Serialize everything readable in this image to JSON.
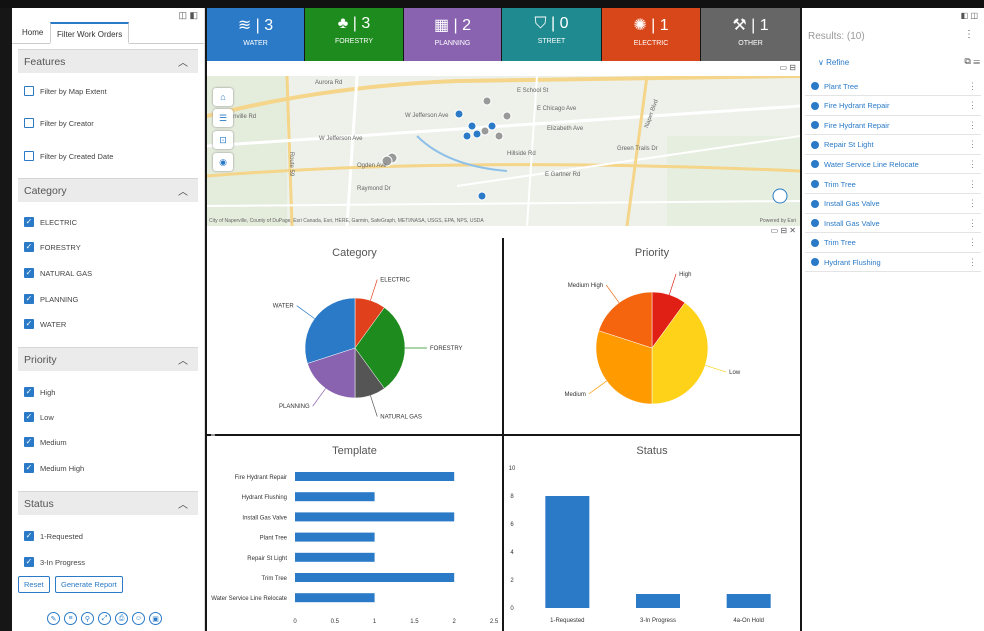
{
  "left_panel": {
    "tabs": [
      "Home",
      "Filter Work Orders"
    ],
    "features": {
      "title": "Features",
      "items": [
        "Filter by Map Extent",
        "Filter by Creator",
        "Filter by Created Date"
      ]
    },
    "category": {
      "title": "Category",
      "items": [
        "ELECTRIC",
        "FORESTRY",
        "NATURAL GAS",
        "PLANNING",
        "WATER"
      ]
    },
    "priority": {
      "title": "Priority",
      "items": [
        "High",
        "Low",
        "Medium",
        "Medium High"
      ]
    },
    "status": {
      "title": "Status",
      "items": [
        "1-Requested",
        "3-In Progress"
      ]
    },
    "reset_label": "Reset",
    "report_label": "Generate Report"
  },
  "tiles": [
    {
      "count": "3",
      "label": "WATER",
      "color": "#2a7ac7"
    },
    {
      "count": "3",
      "label": "FORESTRY",
      "color": "#1e8b1e"
    },
    {
      "count": "2",
      "label": "PLANNING",
      "color": "#8a63b0"
    },
    {
      "count": "0",
      "label": "STREET",
      "color": "#1f8a8f"
    },
    {
      "count": "1",
      "label": "ELECTRIC",
      "color": "#d8471a"
    },
    {
      "count": "1",
      "label": "OTHER",
      "color": "#666666"
    }
  ],
  "map": {
    "attribution": "City of Naperville, County of DuPage, Esri Canada, Esri, HERE, Garmin, SafeGraph, METI/NASA, USGS, EPA, NPS, USDA",
    "powered": "Powered by Esri",
    "roads": [
      "Aurora Rd",
      "W Jefferson Ave",
      "W Jefferson Ave",
      "E Chicago Ave",
      "Ogden Ave",
      "Hillside Rd",
      "E Gartner Rd",
      "Route 59",
      "E School St",
      "Elizabeth Ave",
      "Naper Blvd",
      "Green Trails Dr",
      "Raymond Dr",
      "Warrenville Rd"
    ]
  },
  "results": {
    "title": "Results: (10)",
    "refine": "Refine",
    "items": [
      "Plant Tree",
      "Fire Hydrant Repair",
      "Fire Hydrant Repair",
      "Repair St Light",
      "Water Service Line Relocate",
      "Trim Tree",
      "Install Gas Valve",
      "Install Gas Valve",
      "Trim Tree",
      "Hydrant Flushing"
    ]
  },
  "chart_data": [
    {
      "type": "pie",
      "title": "Category",
      "categories": [
        "ELECTRIC",
        "FORESTRY",
        "NATURAL GAS",
        "PLANNING",
        "WATER"
      ],
      "values": [
        1,
        3,
        1,
        2,
        3
      ],
      "colors": [
        "#e0401c",
        "#1e8b1e",
        "#555555",
        "#8a63b0",
        "#2a7ac7"
      ]
    },
    {
      "type": "pie",
      "title": "Priority",
      "categories": [
        "High",
        "Low",
        "Medium",
        "Medium High"
      ],
      "values": [
        1,
        4,
        3,
        2
      ],
      "colors": [
        "#e02014",
        "#ffd21a",
        "#ff9a00",
        "#f4650d"
      ]
    },
    {
      "type": "bar",
      "title": "Template",
      "orientation": "horizontal",
      "categories": [
        "Fire Hydrant Repair",
        "Hydrant Flushing",
        "Install Gas Valve",
        "Plant Tree",
        "Repair St Light",
        "Trim Tree",
        "Water Service Line Relocate"
      ],
      "values": [
        2,
        1,
        2,
        1,
        1,
        2,
        1
      ],
      "xlim": [
        0,
        2.5
      ],
      "xticks": [
        "0",
        "0.5",
        "1",
        "1.5",
        "2",
        "2.5"
      ],
      "color": "#2a7ac7"
    },
    {
      "type": "bar",
      "title": "Status",
      "categories": [
        "1-Requested",
        "3-In Progress",
        "4a-On Hold"
      ],
      "values": [
        8,
        1,
        1
      ],
      "ylim": [
        0,
        10
      ],
      "yticks": [
        "0",
        "2",
        "4",
        "6",
        "8",
        "10"
      ],
      "color": "#2a7ac7"
    }
  ]
}
